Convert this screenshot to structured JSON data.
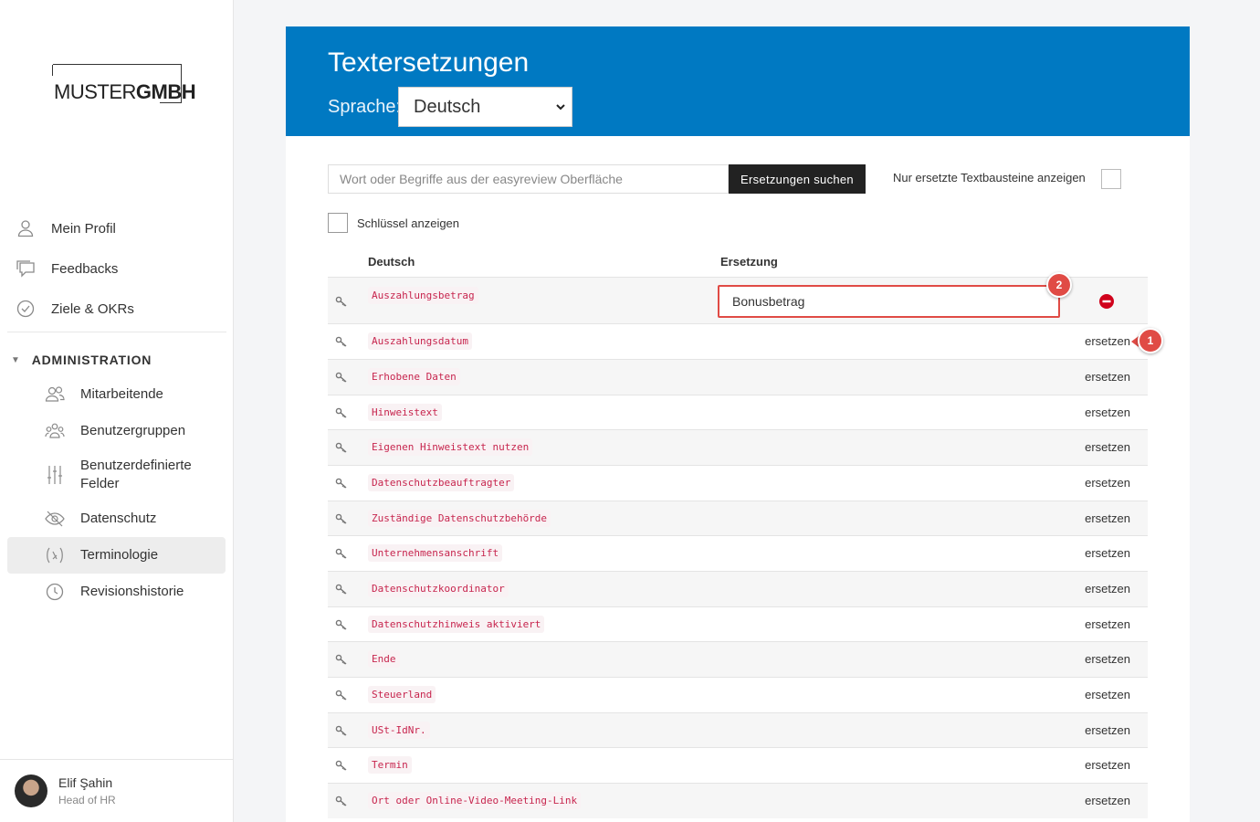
{
  "logo": {
    "thin": "MUSTER",
    "bold": "GMBH"
  },
  "nav": {
    "items": [
      {
        "label": "Mein Profil",
        "icon": "user-icon"
      },
      {
        "label": "Feedbacks",
        "icon": "chat-icon"
      },
      {
        "label": "Ziele & OKRs",
        "icon": "check-circle-icon"
      }
    ],
    "admin_header": "ADMINISTRATION",
    "admin_items": [
      {
        "label": "Mitarbeitende",
        "icon": "people-icon"
      },
      {
        "label": "Benutzergruppen",
        "icon": "groups-icon"
      },
      {
        "label": "Benutzerdefinierte Felder",
        "icon": "sliders-icon"
      },
      {
        "label": "Datenschutz",
        "icon": "eye-off-icon"
      },
      {
        "label": "Terminologie",
        "icon": "function-icon"
      },
      {
        "label": "Revisionshistorie",
        "icon": "clock-icon"
      }
    ]
  },
  "user": {
    "name": "Elif Şahin",
    "role": "Head of HR"
  },
  "header": {
    "title": "Textersetzungen",
    "language_label": "Sprache:",
    "language_value": "Deutsch"
  },
  "search": {
    "placeholder": "Wort oder Begriffe aus der easyreview Oberfläche",
    "button_label": "Ersetzungen suchen",
    "only_replaced_label": "Nur ersetzte Textbausteine anzeigen",
    "show_keys_label": "Schlüssel anzeigen"
  },
  "table": {
    "col_german": "Deutsch",
    "col_replacement": "Ersetzung",
    "edit_row": {
      "key": "Auszahlungsbetrag",
      "replacement": "Bonusbetrag"
    },
    "action_label": "ersetzen",
    "rows": [
      "Auszahlungsdatum",
      "Erhobene Daten",
      "Hinweistext",
      "Eigenen Hinweistext nutzen",
      "Datenschutzbeauftragter",
      "Zuständige Datenschutzbehörde",
      "Unternehmensanschrift",
      "Datenschutzkoordinator",
      "Datenschutzhinweis aktiviert",
      "Ende",
      "Steuerland",
      "USt-IdNr.",
      "Termin",
      "Ort oder Online-Video-Meeting-Link"
    ]
  },
  "annotations": {
    "badge_1": "1",
    "badge_2": "2"
  },
  "colors": {
    "brand_blue": "#0079c2",
    "accent_red": "#e04b45",
    "code_red": "#c7254e"
  }
}
